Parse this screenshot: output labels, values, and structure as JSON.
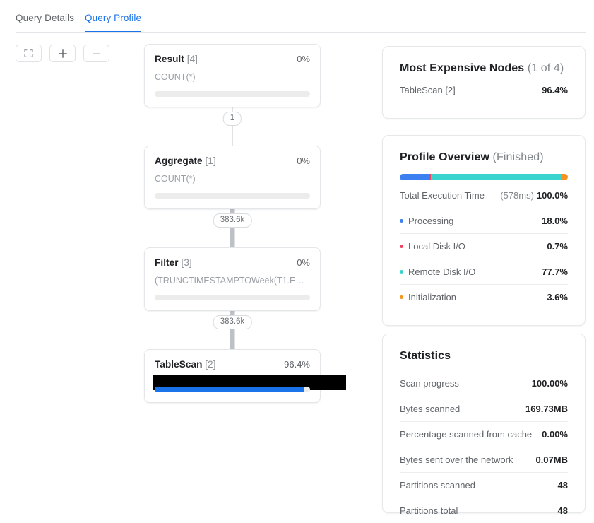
{
  "tabs": [
    {
      "label": "Query Details",
      "active": false
    },
    {
      "label": "Query Profile",
      "active": true
    }
  ],
  "toolbar": {
    "fit_label": "fit-to-screen",
    "zoom_in_label": "zoom-in",
    "zoom_out_label": "zoom-out"
  },
  "graph": {
    "nodes": [
      {
        "title": "Result",
        "id": "[4]",
        "pct": "0%",
        "sub": "COUNT(*)",
        "bar_pct": 0,
        "redacted": false
      },
      {
        "title": "Aggregate",
        "id": "[1]",
        "pct": "0%",
        "sub": "COUNT(*)",
        "bar_pct": 0,
        "redacted": false
      },
      {
        "title": "Filter",
        "id": "[3]",
        "pct": "0%",
        "sub": "(TRUNCTIMESTAMPTOWeek(T1.EVENT…",
        "bar_pct": 0,
        "redacted": false
      },
      {
        "title": "TableScan",
        "id": "[2]",
        "pct": "96.4%",
        "sub": "",
        "bar_pct": 96.4,
        "redacted": true
      }
    ],
    "edges": [
      {
        "label": "1"
      },
      {
        "label": "383.6k"
      },
      {
        "label": "383.6k"
      }
    ]
  },
  "expensive": {
    "title": "Most Expensive Nodes",
    "title_suffix": "(1 of 4)",
    "rows": [
      {
        "label": "TableScan [2]",
        "value": "96.4%"
      }
    ]
  },
  "overview": {
    "title": "Profile Overview",
    "title_suffix": "(Finished)",
    "total_label": "Total Execution Time",
    "total_time": "(578ms)",
    "total_pct": "100.0%",
    "segments": [
      {
        "name": "Processing",
        "pct": 18.0,
        "color": "#3b7ff0"
      },
      {
        "name": "Local Disk I/O",
        "pct": 0.7,
        "color": "#f0435c"
      },
      {
        "name": "Remote Disk I/O",
        "pct": 77.7,
        "color": "#3ad4cf"
      },
      {
        "name": "Initialization",
        "pct": 3.6,
        "color": "#f7921e"
      }
    ],
    "rows": [
      {
        "label": "Processing",
        "value": "18.0%",
        "color": "#3b7ff0"
      },
      {
        "label": "Local Disk I/O",
        "value": "0.7%",
        "color": "#f0435c"
      },
      {
        "label": "Remote Disk I/O",
        "value": "77.7%",
        "color": "#3ad4cf"
      },
      {
        "label": "Initialization",
        "value": "3.6%",
        "color": "#f7921e"
      }
    ]
  },
  "statistics": {
    "title": "Statistics",
    "rows": [
      {
        "label": "Scan progress",
        "value": "100.00%"
      },
      {
        "label": "Bytes scanned",
        "value": "169.73MB"
      },
      {
        "label": "Percentage scanned from cache",
        "value": "0.00%"
      },
      {
        "label": "Bytes sent over the network",
        "value": "0.07MB"
      },
      {
        "label": "Partitions scanned",
        "value": "48"
      },
      {
        "label": "Partitions total",
        "value": "48"
      }
    ]
  }
}
